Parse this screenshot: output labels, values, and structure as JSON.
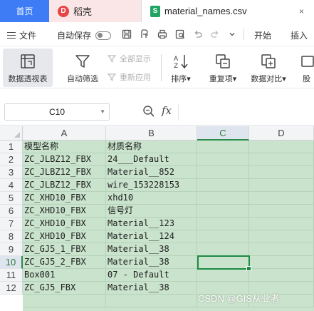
{
  "tabs": {
    "home": "首页",
    "docer": "稻壳",
    "docer_logo": "D",
    "file": "material_names.csv",
    "file_logo": "S",
    "close": "×"
  },
  "menubar": {
    "file": "文件",
    "autosave": "自动保存",
    "start": "开始",
    "insert": "插入"
  },
  "ribbon": {
    "pivot": "数据透视表",
    "autofilter": "自动筛选",
    "show_all": "全部显示",
    "reapply": "重新应用",
    "sort": "排序",
    "duplicates": "重复项",
    "compare": "数据对比",
    "more": "股",
    "dropdown_mark": "▾"
  },
  "formula": {
    "cell_ref": "C10",
    "fx": "fx",
    "value": ""
  },
  "sheet": {
    "columns": [
      "A",
      "B",
      "C",
      "D"
    ],
    "selected_column": "C",
    "rows": [
      "1",
      "2",
      "3",
      "4",
      "5",
      "6",
      "7",
      "8",
      "9",
      "10",
      "11",
      "12"
    ],
    "selected_row": "10",
    "cells": [
      [
        "模型名称",
        "材质名称"
      ],
      [
        "ZC_JLBZ12_FBX",
        "24___Default"
      ],
      [
        "ZC_JLBZ12_FBX",
        "Material__852"
      ],
      [
        "ZC_JLBZ12_FBX",
        "wire_153228153"
      ],
      [
        "ZC_XHD10_FBX",
        "xhd10"
      ],
      [
        "ZC_XHD10_FBX",
        "信号灯"
      ],
      [
        "ZC_XHD10_FBX",
        "Material__123"
      ],
      [
        "ZC_XHD10_FBX",
        "Material__124"
      ],
      [
        "ZC_GJ5_1_FBX",
        "Material__38"
      ],
      [
        "ZC_GJ5_2_FBX",
        "Material__38"
      ],
      [
        "Box001",
        "07 - Default"
      ],
      [
        "ZC_GJ5_FBX",
        "Material__38"
      ]
    ]
  },
  "watermark": "CSDN @GIS从业者",
  "colors": {
    "tab_active": "#3d7cf5",
    "grid_fill": "#c9e3cc",
    "selection": "#1e8b45"
  }
}
